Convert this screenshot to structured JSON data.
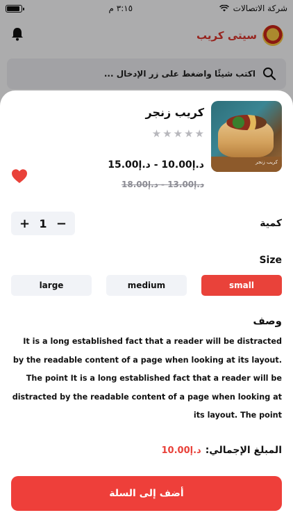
{
  "status_bar": {
    "carrier": "شركة الاتصالات",
    "time": "٣:١٥ م",
    "battery_level": 0.9
  },
  "header": {
    "brand_name": "سيتى كريب",
    "icons": {
      "notifications": "bell-icon",
      "logo": "brand-logo"
    }
  },
  "search": {
    "placeholder": "اكتب شيئًا واضغط على زر الإدخال ..."
  },
  "product": {
    "name": "كريب زنجر",
    "rating": 0,
    "rating_max": 5,
    "price_range": "د.إ10.00 - د.إ15.00",
    "old_price_range": "د.إ13.00 - د.إ18.00",
    "image_watermark": "كريب زنجر",
    "favorite": true
  },
  "quantity": {
    "label": "كمية",
    "value": "1",
    "minus": "−",
    "plus": "+"
  },
  "size": {
    "label": "Size",
    "options": [
      "large",
      "medium",
      "small"
    ],
    "selected": "small"
  },
  "description": {
    "label": "وصف",
    "text": "It is a long established fact that a reader will be distracted by the readable content of a page when looking at its layout. The point It is a long established fact that a reader will be distracted by the readable content of a page when looking at its layout. The point"
  },
  "total": {
    "label": "المبلغ الإجمالي:",
    "amount": "د.إ10.00"
  },
  "add_to_cart": {
    "label": "أضف إلى السلة"
  },
  "colors": {
    "accent": "#ee3f3a",
    "brand_text": "#d9342b",
    "chip_bg": "#f1f3f7"
  }
}
